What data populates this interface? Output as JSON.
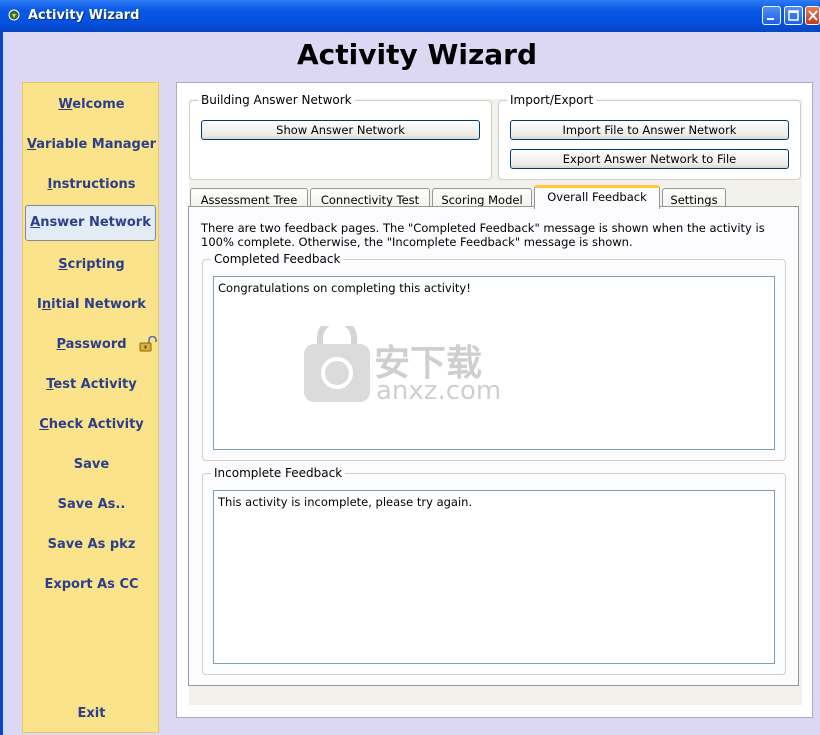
{
  "window": {
    "title": "Activity Wizard"
  },
  "app_title": "Activity Wizard",
  "sidebar": {
    "items": [
      {
        "label": "Welcome",
        "underline": "W",
        "rest": "elcome"
      },
      {
        "label": "Variable Manager",
        "underline": "V",
        "rest": "ariable Manager"
      },
      {
        "label": "Instructions",
        "underline": "I",
        "rest": "nstructions"
      },
      {
        "label": "Answer Network",
        "underline": "A",
        "rest": "nswer Network"
      },
      {
        "label": "Scripting",
        "underline": "S",
        "rest": "cripting"
      },
      {
        "label": "Initial Network",
        "pre": "I",
        "underline": "n",
        "rest": "itial Network"
      },
      {
        "label": "Password",
        "underline": "P",
        "rest": "assword"
      },
      {
        "label": "Test Activity",
        "underline": "T",
        "rest": "est Activity"
      },
      {
        "label": "Check Activity",
        "underline": "C",
        "rest": "heck Activity"
      },
      {
        "label": "Save"
      },
      {
        "label": "Save As.."
      },
      {
        "label": "Save As pkz"
      },
      {
        "label": "Export As CC"
      },
      {
        "label": "Exit"
      }
    ],
    "active_index": 3,
    "password_icon": "unlocked-padlock-icon"
  },
  "building_group": {
    "label": "Building Answer Network",
    "show_button": "Show Answer Network"
  },
  "import_export_group": {
    "label": "Import/Export",
    "import_button": "Import File to Answer Network",
    "export_button": "Export Answer Network to File"
  },
  "tabs": [
    {
      "label": "Assessment Tree"
    },
    {
      "label": "Connectivity Test"
    },
    {
      "label": "Scoring Model"
    },
    {
      "label": "Overall Feedback"
    },
    {
      "label": "Settings"
    }
  ],
  "active_tab": "Overall Feedback",
  "feedback": {
    "intro_line1": "There are two feedback pages. The \"Completed Feedback\" message is shown when the activity is",
    "intro_line2": "100% complete. Otherwise, the \"Incomplete Feedback\" message is shown.",
    "completed_label": "Completed Feedback",
    "completed_text": "Congratulations on completing this activity!",
    "incomplete_label": "Incomplete Feedback",
    "incomplete_text": "This activity is incomplete, please try again."
  },
  "watermark": {
    "chinese": "安下载",
    "latin": "anxz.com"
  },
  "colors": {
    "sidebar_bg": "#fbe38c",
    "nav_text": "#2b3f8a",
    "frame_bg": "#dcd8f4",
    "titlebar": "#0551df",
    "active_tab_accent": "#ffc83c"
  }
}
